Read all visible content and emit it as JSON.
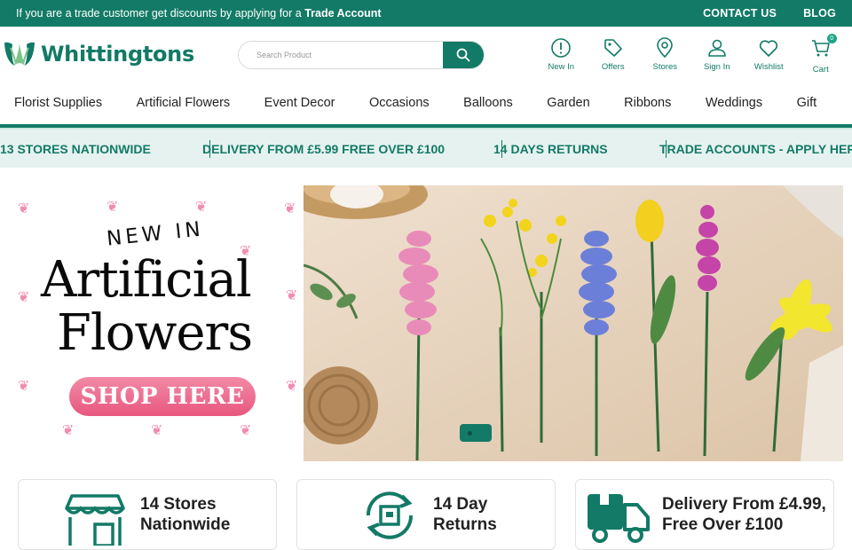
{
  "topbar": {
    "promo_prefix": "If you are a trade customer get discounts by applying for a",
    "promo_link": "Trade Account",
    "contact": "CONTACT US",
    "blog": "BLOG"
  },
  "header": {
    "logo_text": "Whittingtons",
    "search_placeholder": "Search Product",
    "icons": [
      {
        "label": "New In",
        "icon": "info-circle-icon"
      },
      {
        "label": "Offers",
        "icon": "tag-icon"
      },
      {
        "label": "Stores",
        "icon": "map-pin-icon"
      },
      {
        "label": "Sign In",
        "icon": "user-icon"
      },
      {
        "label": "Wishlist",
        "icon": "heart-icon"
      },
      {
        "label": "Cart",
        "icon": "cart-icon",
        "count": "0"
      }
    ]
  },
  "nav": [
    "Florist Supplies",
    "Artificial Flowers",
    "Event Decor",
    "Occasions",
    "Balloons",
    "Garden",
    "Ribbons",
    "Weddings",
    "Gift"
  ],
  "ticker": [
    "13 STORES NATIONWIDE",
    "DELIVERY FROM £5.99 FREE OVER £100",
    "14 DAYS RETURNS",
    "TRADE ACCOUNTS - APPLY HERE"
  ],
  "hero": {
    "kicker": "NEW IN",
    "title_line1": "Artificial",
    "title_line2": "Flowers",
    "cta": "SHOP HERE"
  },
  "features": [
    {
      "line1": "14 Stores",
      "line2": "Nationwide",
      "icon": "storefront-icon"
    },
    {
      "line1": "14 Day",
      "line2": "Returns",
      "icon": "returns-box-icon"
    },
    {
      "line1": "Delivery From £4.99,",
      "line2": "Free Over £100",
      "icon": "delivery-truck-icon"
    }
  ],
  "colors": {
    "brand": "#127a66",
    "accent_pink": "#e8577e"
  }
}
